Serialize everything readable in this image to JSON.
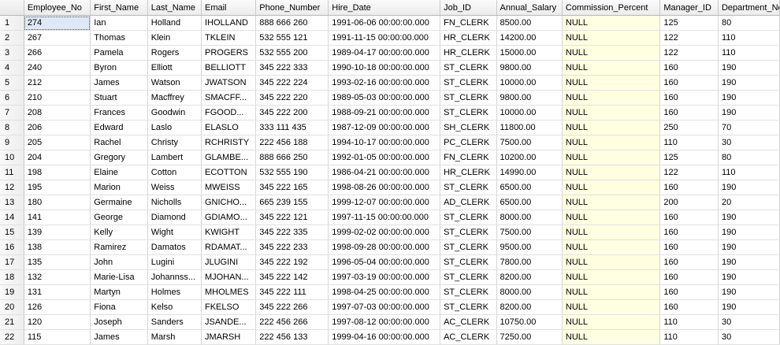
{
  "columns": [
    "Employee_No",
    "First_Name",
    "Last_Name",
    "Email",
    "Phone_Number",
    "Hire_Date",
    "Job_ID",
    "Annual_Salary",
    "Commission_Percent",
    "Manager_ID",
    "Department_No"
  ],
  "rows": [
    {
      "n": "1",
      "c": [
        "274",
        "Ian",
        "Holland",
        "IHOLLAND",
        "888 666 260",
        "1991-06-06 00:00:00.000",
        "FN_CLERK",
        "8500.00",
        "NULL",
        "125",
        "80"
      ]
    },
    {
      "n": "2",
      "c": [
        "267",
        "Thomas",
        "Klein",
        "TKLEIN",
        "532 555 121",
        "1991-11-15 00:00:00.000",
        "HR_CLERK",
        "14200.00",
        "NULL",
        "122",
        "110"
      ]
    },
    {
      "n": "3",
      "c": [
        "266",
        "Pamela",
        "Rogers",
        "PROGERS",
        "532 555 200",
        "1989-04-17 00:00:00.000",
        "HR_CLERK",
        "15000.00",
        "NULL",
        "122",
        "110"
      ]
    },
    {
      "n": "4",
      "c": [
        "240",
        "Byron",
        "Elliott",
        "BELLIOTT",
        "345 222 333",
        "1990-10-18 00:00:00.000",
        "ST_CLERK",
        "9800.00",
        "NULL",
        "160",
        "190"
      ]
    },
    {
      "n": "5",
      "c": [
        "212",
        "James",
        "Watson",
        "JWATSON",
        "345 222 224",
        "1993-02-16 00:00:00.000",
        "ST_CLERK",
        "10000.00",
        "NULL",
        "160",
        "190"
      ]
    },
    {
      "n": "6",
      "c": [
        "210",
        "Stuart",
        "Macffrey",
        "SMACFF...",
        "345 222 220",
        "1989-05-03 00:00:00.000",
        "ST_CLERK",
        "9800.00",
        "NULL",
        "160",
        "190"
      ]
    },
    {
      "n": "7",
      "c": [
        "208",
        "Frances",
        "Goodwin",
        "FGOOD...",
        "345 222 200",
        "1988-09-21 00:00:00.000",
        "ST_CLERK",
        "10000.00",
        "NULL",
        "160",
        "190"
      ]
    },
    {
      "n": "8",
      "c": [
        "206",
        "Edward",
        "Laslo",
        "ELASLO",
        "333 111 435",
        "1987-12-09 00:00:00.000",
        "SH_CLERK",
        "11800.00",
        "NULL",
        "250",
        "70"
      ]
    },
    {
      "n": "9",
      "c": [
        "205",
        "Rachel",
        "Christy",
        "RCHRISTY",
        "222 456 188",
        "1994-10-17 00:00:00.000",
        "PC_CLERK",
        "7500.00",
        "NULL",
        "110",
        "30"
      ]
    },
    {
      "n": "10",
      "c": [
        "204",
        "Gregory",
        "Lambert",
        "GLAMBE...",
        "888 666 250",
        "1992-01-05 00:00:00.000",
        "FN_CLERK",
        "10200.00",
        "NULL",
        "125",
        "80"
      ]
    },
    {
      "n": "11",
      "c": [
        "198",
        "Elaine",
        "Cotton",
        "ECOTTON",
        "532 555 190",
        "1986-04-21 00:00:00.000",
        "HR_CLERK",
        "14990.00",
        "NULL",
        "122",
        "110"
      ]
    },
    {
      "n": "12",
      "c": [
        "195",
        "Marion",
        "Weiss",
        "MWEISS",
        "345 222 165",
        "1998-08-26 00:00:00.000",
        "ST_CLERK",
        "6500.00",
        "NULL",
        "160",
        "190"
      ]
    },
    {
      "n": "13",
      "c": [
        "180",
        "Germaine",
        "Nicholls",
        "GNICHO...",
        "665 239 155",
        "1999-12-07 00:00:00.000",
        "AD_CLERK",
        "6500.00",
        "NULL",
        "200",
        "20"
      ]
    },
    {
      "n": "14",
      "c": [
        "141",
        "George",
        "Diamond",
        "GDIAMO...",
        "345 222 121",
        "1997-11-15 00:00:00.000",
        "ST_CLERK",
        "8000.00",
        "NULL",
        "160",
        "190"
      ]
    },
    {
      "n": "15",
      "c": [
        "139",
        "Kelly",
        "Wight",
        "KWIGHT",
        "345 222 335",
        "1999-02-02 00:00:00.000",
        "ST_CLERK",
        "7500.00",
        "NULL",
        "160",
        "190"
      ]
    },
    {
      "n": "16",
      "c": [
        "138",
        "Ramirez",
        "Damatos",
        "RDAMAT...",
        "345 222 233",
        "1998-09-28 00:00:00.000",
        "ST_CLERK",
        "9500.00",
        "NULL",
        "160",
        "190"
      ]
    },
    {
      "n": "17",
      "c": [
        "135",
        "John",
        "Lugini",
        "JLUGINI",
        "345 222 192",
        "1996-05-04 00:00:00.000",
        "ST_CLERK",
        "7800.00",
        "NULL",
        "160",
        "190"
      ]
    },
    {
      "n": "18",
      "c": [
        "132",
        "Marie-Lisa",
        "Johannss...",
        "MJOHAN...",
        "345 222 142",
        "1997-03-19 00:00:00.000",
        "ST_CLERK",
        "8200.00",
        "NULL",
        "160",
        "190"
      ]
    },
    {
      "n": "19",
      "c": [
        "131",
        "Martyn",
        "Holmes",
        "MHOLMES",
        "345 222 111",
        "1998-04-25 00:00:00.000",
        "ST_CLERK",
        "8000.00",
        "NULL",
        "160",
        "190"
      ]
    },
    {
      "n": "20",
      "c": [
        "126",
        "Fiona",
        "Kelso",
        "FKELSO",
        "345 222 266",
        "1997-07-03 00:00:00.000",
        "ST_CLERK",
        "8200.00",
        "NULL",
        "160",
        "190"
      ]
    },
    {
      "n": "21",
      "c": [
        "120",
        "Joseph",
        "Sanders",
        "JSANDE...",
        "222 456 266",
        "1997-08-12 00:00:00.000",
        "AC_CLERK",
        "10750.00",
        "NULL",
        "110",
        "30"
      ]
    },
    {
      "n": "22",
      "c": [
        "115",
        "James",
        "Marsh",
        "JMARSH",
        "222 456 133",
        "1999-04-16 00:00:00.000",
        "AC_CLERK",
        "7250.00",
        "NULL",
        "110",
        "30"
      ]
    }
  ],
  "colors": {
    "null_cell": "#ffffe1",
    "header": "#ececec",
    "selected_cell": "#dfe9f6"
  }
}
